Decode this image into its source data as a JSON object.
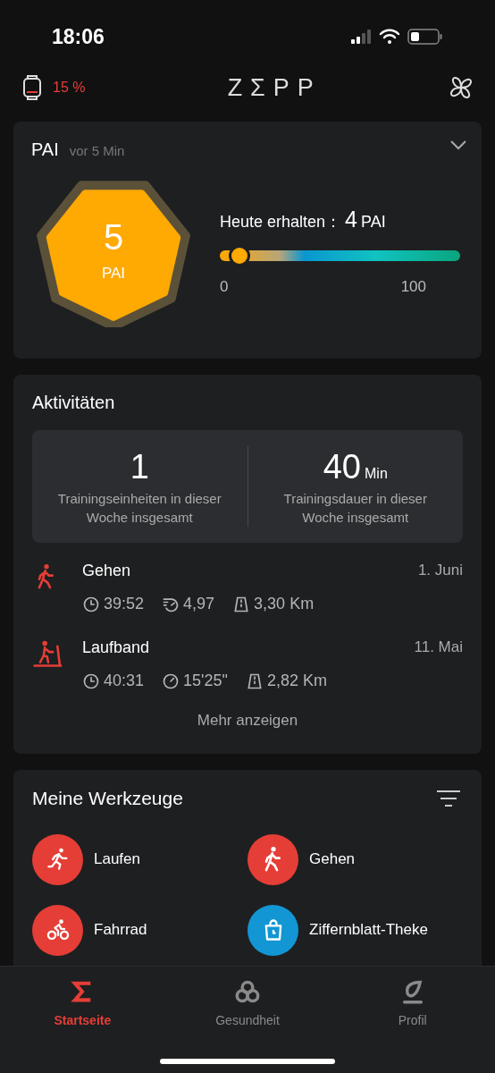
{
  "status_bar": {
    "time": "18:06"
  },
  "header": {
    "watch_battery": "15 %",
    "logo": "ZΣPP"
  },
  "pai_card": {
    "title": "PAI",
    "updated": "vor 5 Min",
    "score": "5",
    "score_unit": "PAI",
    "today_label": "Heute erhalten：",
    "today_value": "4",
    "today_unit": "PAI",
    "level": 0.08,
    "scale_min": "0",
    "scale_max": "100"
  },
  "activities": {
    "title": "Aktivitäten",
    "summary": [
      {
        "value": "1",
        "label": "Trainingseinheiten in dieser Woche insgesamt"
      },
      {
        "value": "40",
        "unit": "Min",
        "label": "Trainingsdauer in dieser Woche insgesamt"
      }
    ],
    "items": [
      {
        "kind": "walk",
        "name": "Gehen",
        "date": "1. Juni",
        "stats": [
          {
            "kind": "duration",
            "value": "39:52"
          },
          {
            "kind": "speed",
            "value": "4,97"
          },
          {
            "kind": "distance",
            "value": "3,30 Km"
          }
        ]
      },
      {
        "kind": "treadmill",
        "name": "Laufband",
        "date": "11. Mai",
        "stats": [
          {
            "kind": "duration",
            "value": "40:31"
          },
          {
            "kind": "pace",
            "value": "15'25\""
          },
          {
            "kind": "distance",
            "value": "2,82 Km"
          }
        ]
      }
    ],
    "more": "Mehr anzeigen"
  },
  "tools": {
    "title": "Meine Werkzeuge",
    "items": [
      {
        "kind": "run",
        "label": "Laufen",
        "color": "#e53e36"
      },
      {
        "kind": "walk",
        "label": "Gehen",
        "color": "#e53e36"
      },
      {
        "kind": "bike",
        "label": "Fahrrad",
        "color": "#e53e36"
      },
      {
        "kind": "shop",
        "label": "Ziffernblatt-Theke",
        "color": "#1296d4"
      }
    ]
  },
  "tab_bar": [
    {
      "kind": "home",
      "label": "Startseite",
      "selected": true
    },
    {
      "kind": "health",
      "label": "Gesundheit",
      "selected": false
    },
    {
      "kind": "profile",
      "label": "Profil",
      "selected": false
    }
  ]
}
